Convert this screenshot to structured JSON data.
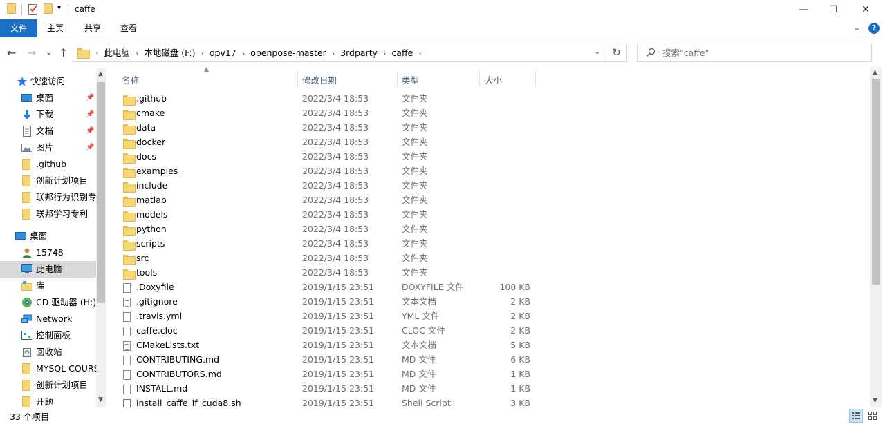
{
  "window": {
    "title": "caffe",
    "minimize": "—",
    "maximize": "☐",
    "close": "✕"
  },
  "ribbon": {
    "tabs": [
      "文件",
      "主页",
      "共享",
      "查看"
    ],
    "expand": "⌄",
    "help": "?"
  },
  "nav_buttons": {
    "back": "←",
    "forward": "→",
    "recent": "⌄",
    "up": "↑"
  },
  "address": {
    "crumbs": [
      "此电脑",
      "本地磁盘 (F:)",
      "opv17",
      "openpose-master",
      "3rdparty",
      "caffe"
    ],
    "dropdown": "⌄",
    "refresh": "↻"
  },
  "search": {
    "placeholder": "搜索\"caffe\""
  },
  "sidebar": {
    "quick_access": {
      "label": "快速访问",
      "items": [
        {
          "label": "桌面",
          "icon": "desktop-icon",
          "pinned": true
        },
        {
          "label": "下载",
          "icon": "download-icon",
          "pinned": true
        },
        {
          "label": "文档",
          "icon": "document-icon",
          "pinned": true
        },
        {
          "label": "图片",
          "icon": "picture-icon",
          "pinned": true
        },
        {
          "label": ".github",
          "icon": "folder-icon",
          "pinned": false
        },
        {
          "label": "创新计划项目",
          "icon": "folder-icon",
          "pinned": false
        },
        {
          "label": "联邦行为识别专",
          "icon": "folder-icon",
          "pinned": false
        },
        {
          "label": "联邦学习专利",
          "icon": "folder-icon",
          "pinned": false
        }
      ]
    },
    "desktop_tree": {
      "label": "桌面",
      "items": [
        {
          "label": "15748",
          "icon": "user-icon"
        },
        {
          "label": "此电脑",
          "icon": "computer-icon",
          "selected": true
        },
        {
          "label": "库",
          "icon": "library-icon"
        },
        {
          "label": "CD 驱动器 (H:)",
          "icon": "cd-drive-icon"
        },
        {
          "label": "Network",
          "icon": "network-icon"
        },
        {
          "label": "控制面板",
          "icon": "control-panel-icon"
        },
        {
          "label": "回收站",
          "icon": "recycle-bin-icon"
        },
        {
          "label": "MYSQL COURSE",
          "icon": "folder-icon"
        },
        {
          "label": "创新计划项目",
          "icon": "folder-icon"
        },
        {
          "label": "开题",
          "icon": "folder-icon"
        }
      ]
    }
  },
  "columns": {
    "name": "名称",
    "date": "修改日期",
    "type": "类型",
    "size": "大小"
  },
  "files": [
    {
      "name": ".github",
      "date": "2022/3/4 18:53",
      "type": "文件夹",
      "size": "",
      "kind": "folder"
    },
    {
      "name": "cmake",
      "date": "2022/3/4 18:53",
      "type": "文件夹",
      "size": "",
      "kind": "folder"
    },
    {
      "name": "data",
      "date": "2022/3/4 18:53",
      "type": "文件夹",
      "size": "",
      "kind": "folder"
    },
    {
      "name": "docker",
      "date": "2022/3/4 18:53",
      "type": "文件夹",
      "size": "",
      "kind": "folder"
    },
    {
      "name": "docs",
      "date": "2022/3/4 18:53",
      "type": "文件夹",
      "size": "",
      "kind": "folder"
    },
    {
      "name": "examples",
      "date": "2022/3/4 18:53",
      "type": "文件夹",
      "size": "",
      "kind": "folder"
    },
    {
      "name": "include",
      "date": "2022/3/4 18:53",
      "type": "文件夹",
      "size": "",
      "kind": "folder"
    },
    {
      "name": "matlab",
      "date": "2022/3/4 18:53",
      "type": "文件夹",
      "size": "",
      "kind": "folder"
    },
    {
      "name": "models",
      "date": "2022/3/4 18:53",
      "type": "文件夹",
      "size": "",
      "kind": "folder"
    },
    {
      "name": "python",
      "date": "2022/3/4 18:53",
      "type": "文件夹",
      "size": "",
      "kind": "folder"
    },
    {
      "name": "scripts",
      "date": "2022/3/4 18:53",
      "type": "文件夹",
      "size": "",
      "kind": "folder"
    },
    {
      "name": "src",
      "date": "2022/3/4 18:53",
      "type": "文件夹",
      "size": "",
      "kind": "folder"
    },
    {
      "name": "tools",
      "date": "2022/3/4 18:53",
      "type": "文件夹",
      "size": "",
      "kind": "folder"
    },
    {
      "name": ".Doxyfile",
      "date": "2019/1/15 23:51",
      "type": "DOXYFILE 文件",
      "size": "100 KB",
      "kind": "file"
    },
    {
      "name": ".gitignore",
      "date": "2019/1/15 23:51",
      "type": "文本文档",
      "size": "2 KB",
      "kind": "text"
    },
    {
      "name": ".travis.yml",
      "date": "2019/1/15 23:51",
      "type": "YML 文件",
      "size": "2 KB",
      "kind": "file"
    },
    {
      "name": "caffe.cloc",
      "date": "2019/1/15 23:51",
      "type": "CLOC 文件",
      "size": "2 KB",
      "kind": "file"
    },
    {
      "name": "CMakeLists.txt",
      "date": "2019/1/15 23:51",
      "type": "文本文档",
      "size": "5 KB",
      "kind": "text"
    },
    {
      "name": "CONTRIBUTING.md",
      "date": "2019/1/15 23:51",
      "type": "MD 文件",
      "size": "6 KB",
      "kind": "file"
    },
    {
      "name": "CONTRIBUTORS.md",
      "date": "2019/1/15 23:51",
      "type": "MD 文件",
      "size": "1 KB",
      "kind": "file"
    },
    {
      "name": "INSTALL.md",
      "date": "2019/1/15 23:51",
      "type": "MD 文件",
      "size": "1 KB",
      "kind": "file"
    },
    {
      "name": "install_caffe_if_cuda8.sh",
      "date": "2019/1/15 23:51",
      "type": "Shell Script",
      "size": "3 KB",
      "kind": "script"
    }
  ],
  "status": {
    "count": "33 个项目"
  },
  "colors": {
    "accent": "#1a6fc7",
    "selected": "#d9d9d9",
    "folder": "#f8d775",
    "header_text": "#4c607a"
  }
}
